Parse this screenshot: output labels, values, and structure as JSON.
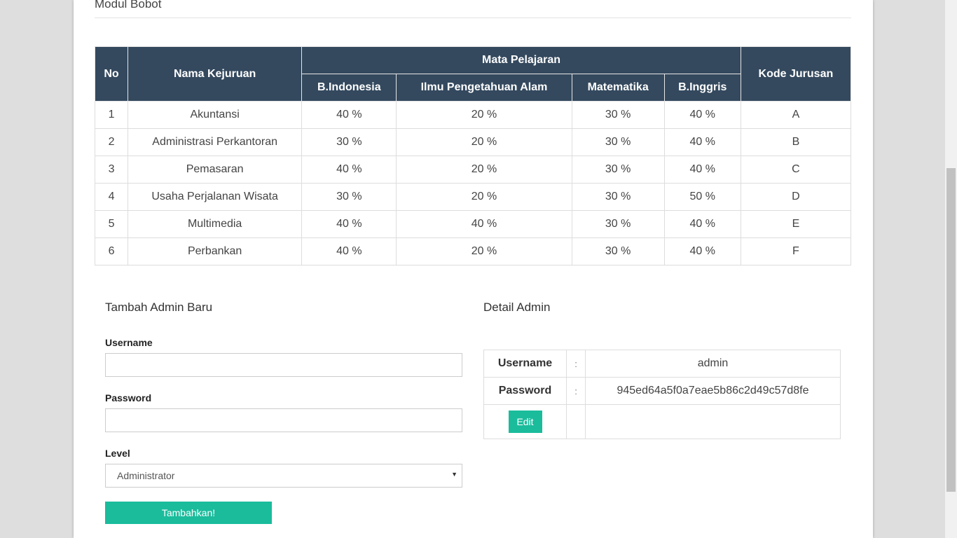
{
  "module_title": "Modul Bobot",
  "weights_table": {
    "headers": {
      "no": "No",
      "nama_kejuruan": "Nama Kejuruan",
      "mata_pelajaran": "Mata Pelajaran",
      "subjects": [
        "B.Indonesia",
        "Ilmu Pengetahuan Alam",
        "Matematika",
        "B.Inggris"
      ],
      "kode_jurusan": "Kode Jurusan"
    },
    "rows": [
      {
        "no": "1",
        "nama": "Akuntansi",
        "bindo": "40 %",
        "ipa": "20 %",
        "mtk": "30 %",
        "bing": "40 %",
        "kode": "A"
      },
      {
        "no": "2",
        "nama": "Administrasi Perkantoran",
        "bindo": "30 %",
        "ipa": "20 %",
        "mtk": "30 %",
        "bing": "40 %",
        "kode": "B"
      },
      {
        "no": "3",
        "nama": "Pemasaran",
        "bindo": "40 %",
        "ipa": "20 %",
        "mtk": "30 %",
        "bing": "40 %",
        "kode": "C"
      },
      {
        "no": "4",
        "nama": "Usaha Perjalanan Wisata",
        "bindo": "30 %",
        "ipa": "20 %",
        "mtk": "30 %",
        "bing": "50 %",
        "kode": "D"
      },
      {
        "no": "5",
        "nama": "Multimedia",
        "bindo": "40 %",
        "ipa": "40 %",
        "mtk": "30 %",
        "bing": "40 %",
        "kode": "E"
      },
      {
        "no": "6",
        "nama": "Perbankan",
        "bindo": "40 %",
        "ipa": "20 %",
        "mtk": "30 %",
        "bing": "40 %",
        "kode": "F"
      }
    ]
  },
  "add_admin": {
    "title": "Tambah Admin Baru",
    "username_label": "Username",
    "username_value": "",
    "password_label": "Password",
    "password_value": "",
    "level_label": "Level",
    "level_selected": "Administrator",
    "submit_label": "Tambahkan!"
  },
  "detail_admin": {
    "title": "Detail Admin",
    "username_label": "Username",
    "username_value": "admin",
    "password_label": "Password",
    "password_value": "945ed64a5f0a7eae5b86c2d49c57d8fe",
    "separator": ":",
    "edit_label": "Edit"
  },
  "colors": {
    "header_bg": "#34495e",
    "accent_green": "#1abc9c"
  },
  "icons": {
    "select_caret": "caret-down-icon"
  }
}
